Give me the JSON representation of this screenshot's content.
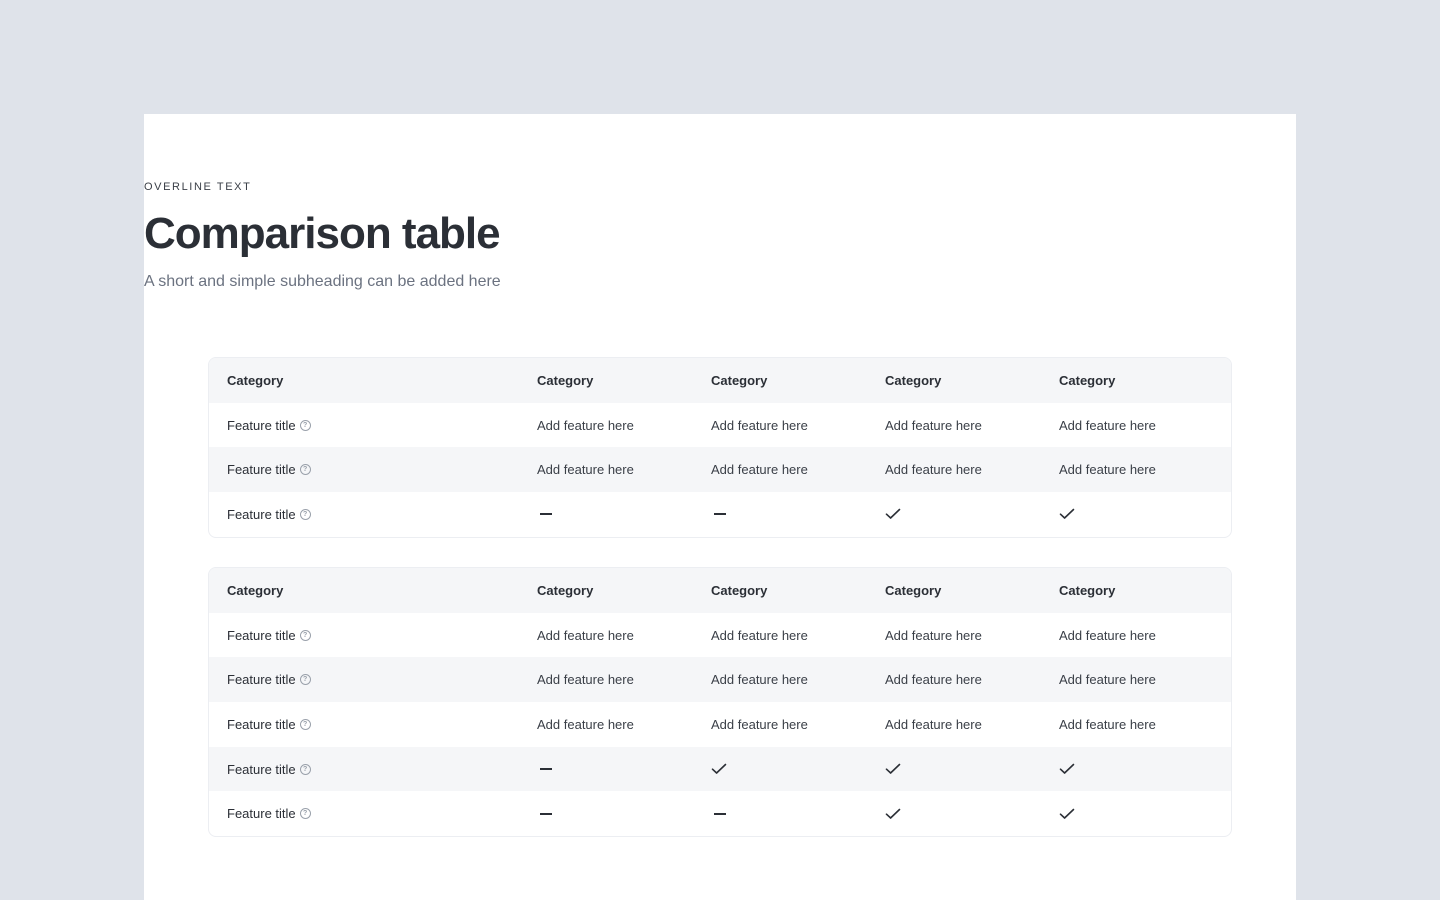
{
  "header": {
    "overline": "OVERLINE TEXT",
    "title": "Comparison table",
    "subtitle": "A short and simple subheading can be added here"
  },
  "tables": [
    {
      "columns": [
        "Category",
        "Category",
        "Category",
        "Category",
        "Category"
      ],
      "rows": [
        {
          "feature": "Feature title",
          "cells": [
            "Add feature here",
            "Add feature here",
            "Add feature here",
            "Add feature here"
          ]
        },
        {
          "feature": "Feature title",
          "cells": [
            "Add feature here",
            "Add feature here",
            "Add feature here",
            "Add feature here"
          ]
        },
        {
          "feature": "Feature title",
          "cells": [
            "dash",
            "dash",
            "check",
            "check"
          ]
        }
      ]
    },
    {
      "columns": [
        "Category",
        "Category",
        "Category",
        "Category",
        "Category"
      ],
      "rows": [
        {
          "feature": "Feature title",
          "cells": [
            "Add feature here",
            "Add feature here",
            "Add feature here",
            "Add feature here"
          ]
        },
        {
          "feature": "Feature title",
          "cells": [
            "Add feature here",
            "Add feature here",
            "Add feature here",
            "Add feature here"
          ]
        },
        {
          "feature": "Feature title",
          "cells": [
            "Add feature here",
            "Add feature here",
            "Add feature here",
            "Add feature here"
          ]
        },
        {
          "feature": "Feature title",
          "cells": [
            "dash",
            "check",
            "check",
            "check"
          ]
        },
        {
          "feature": "Feature title",
          "cells": [
            "dash",
            "dash",
            "check",
            "check"
          ]
        }
      ]
    }
  ],
  "icons": {
    "help": "question-circle-icon",
    "dash": "dash-icon",
    "check": "check-icon"
  },
  "colors": {
    "background": "#dfe3ea",
    "card": "#ffffff",
    "header_row": "#f5f6f8",
    "text": "#2b2f36",
    "muted": "#6b7280"
  }
}
